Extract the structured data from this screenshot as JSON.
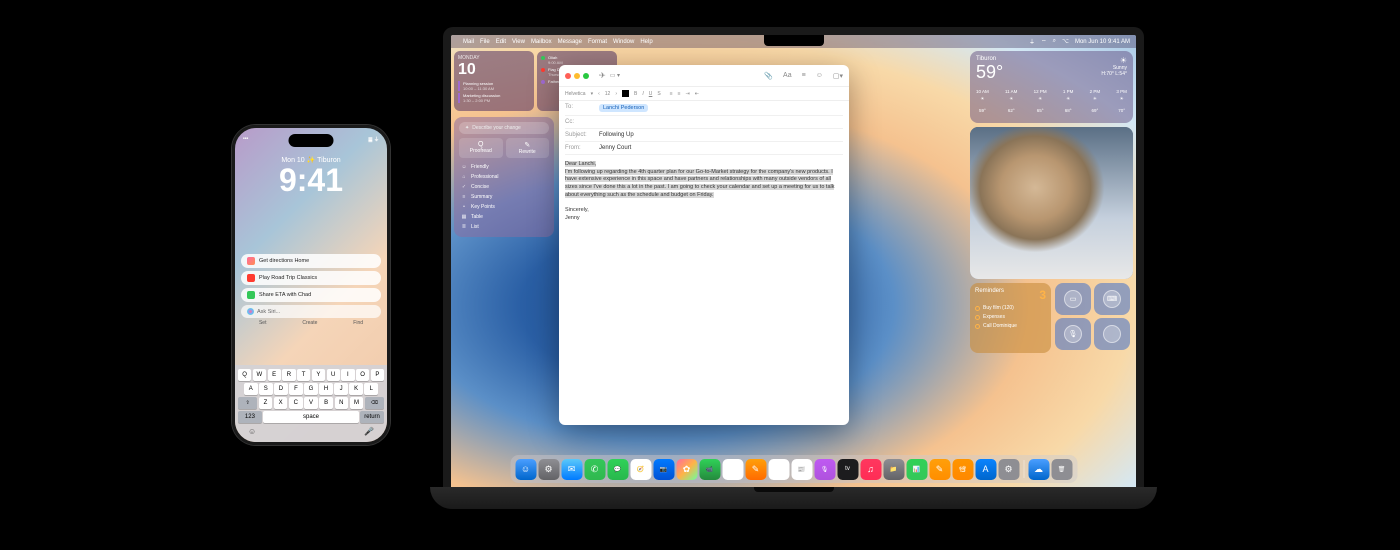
{
  "iphone": {
    "date_line": "Mon 10 ✨ Tiburon",
    "time": "9:41",
    "suggestions": [
      {
        "icon_color": "linear-gradient(135deg,#ff6b9d,#ff8e53)",
        "label": "Get directions Home"
      },
      {
        "icon_color": "#ff3b30",
        "label": "Play Road Trip Classics"
      },
      {
        "icon_color": "#34c759",
        "label": "Share ETA with Chad"
      }
    ],
    "siri_placeholder": "Ask Siri...",
    "tabs": [
      "Set",
      "Create",
      "Find"
    ],
    "keyboard": {
      "r1": [
        "Q",
        "W",
        "E",
        "R",
        "T",
        "Y",
        "U",
        "I",
        "O",
        "P"
      ],
      "r2": [
        "A",
        "S",
        "D",
        "F",
        "G",
        "H",
        "J",
        "K",
        "L"
      ],
      "r3": [
        "⇧",
        "Z",
        "X",
        "C",
        "V",
        "B",
        "N",
        "M",
        "⌫"
      ],
      "r4": [
        "123",
        "space",
        "return"
      ]
    }
  },
  "mac": {
    "menubar_left": [
      "",
      "Mail",
      "File",
      "Edit",
      "View",
      "Mailbox",
      "Message",
      "Format",
      "Window",
      "Help"
    ],
    "menubar_right": "Mon Jun 10  9:41 AM",
    "calendar": {
      "day": "MONDAY",
      "num": "10",
      "items": [
        {
          "title": "Planning session",
          "sub": "10:00 – 11:30 AM"
        },
        {
          "title": "Marketing discussion",
          "sub": "1:30 – 2:00 PM"
        }
      ]
    },
    "calendar2": [
      {
        "color": "#34c759",
        "title": "Oliah",
        "sub": "9:00 AM"
      },
      {
        "color": "#ff3b30",
        "title": "Flag Day",
        "sub": "Thursday, June"
      },
      {
        "color": "#a06ad0",
        "title": "Father's Day",
        "sub": ""
      }
    ],
    "writing": {
      "placeholder": "Describe your change",
      "buttons": [
        "Proofread",
        "Rewrite"
      ],
      "button_icons": [
        "Q",
        "✎"
      ],
      "options": [
        "Friendly",
        "Professional",
        "Concise",
        "Summary",
        "Key Points",
        "Table",
        "List"
      ],
      "option_icons": [
        "☺",
        "⌂",
        "✓",
        "≡",
        "•",
        "▦",
        "≣"
      ]
    },
    "mail": {
      "font": "Helvetica",
      "size": "12",
      "to_label": "To:",
      "to_val": "Lanchi Pederson",
      "cc_label": "Cc:",
      "subject_label": "Subject:",
      "subject_val": "Following Up",
      "from_label": "From:",
      "from_val": "Jenny Court",
      "body_greeting": "Dear Lanchi,",
      "body_para": "I'm following up regarding the 4th quarter plan for our Go-to-Market strategy for the company's new products. I have extensive experience in this space and have partners and relationships with many outside vendors of all sizes since I've done this a lot in the past. I am going to check your calendar and set up a meeting for us to talk about everything such as the schedule and budget on Friday.",
      "body_sign": "Sincerely,",
      "body_name": "Jenny"
    },
    "weather": {
      "location": "Tiburon",
      "temp": "59°",
      "icon": "☀",
      "cond": "Sunny",
      "hilo": "H:70° L:54°",
      "hours": [
        {
          "t": "10 AM",
          "i": "☀",
          "d": "59°"
        },
        {
          "t": "11 AM",
          "i": "☀",
          "d": "62°"
        },
        {
          "t": "12 PM",
          "i": "☀",
          "d": "65°"
        },
        {
          "t": "1 PM",
          "i": "☀",
          "d": "68°"
        },
        {
          "t": "2 PM",
          "i": "☀",
          "d": "69°"
        },
        {
          "t": "3 PM",
          "i": "☀",
          "d": "70°"
        }
      ]
    },
    "reminders": {
      "title": "Reminders",
      "count": "3",
      "items": [
        "Buy film (120)",
        "Expenses",
        "Call Dominique"
      ]
    },
    "dock": [
      {
        "bg": "linear-gradient(#4a9eff,#0066cc)",
        "icon": "☺"
      },
      {
        "bg": "linear-gradient(#8e8e93,#636366)",
        "icon": "⚙"
      },
      {
        "bg": "linear-gradient(#5ac8fa,#007aff)",
        "icon": "✉"
      },
      {
        "bg": "linear-gradient(#34c759,#30b84f)",
        "icon": "✆"
      },
      {
        "bg": "linear-gradient(#30d158,#28b84d)",
        "icon": "💬"
      },
      {
        "bg": "#fff",
        "icon": "🧭"
      },
      {
        "bg": "linear-gradient(#007aff,#0051d5)",
        "icon": "📷"
      },
      {
        "bg": "linear-gradient(135deg,#ff6b9d,#ffb347,#6bff9d)",
        "icon": "✿"
      },
      {
        "bg": "linear-gradient(#30d158,#248a3d)",
        "icon": "📹"
      },
      {
        "bg": "#fff",
        "icon": "10"
      },
      {
        "bg": "linear-gradient(#ff9f0a,#ff6b00)",
        "icon": "✎"
      },
      {
        "bg": "#fff",
        "icon": "✓"
      },
      {
        "bg": "#fff",
        "icon": "📰"
      },
      {
        "bg": "linear-gradient(#bf5af2,#af52de)",
        "icon": "🎙"
      },
      {
        "bg": "#1c1c1e",
        "icon": "tv"
      },
      {
        "bg": "linear-gradient(#ff375f,#ff2d55)",
        "icon": "♫"
      },
      {
        "bg": "linear-gradient(#8e8e93,#636366)",
        "icon": "📁"
      },
      {
        "bg": "linear-gradient(#30d158,#34c759)",
        "icon": "📊"
      },
      {
        "bg": "linear-gradient(#ff9f0a,#ff8e00)",
        "icon": "✎"
      },
      {
        "bg": "linear-gradient(#ff9500,#ff8800)",
        "icon": "📽"
      },
      {
        "bg": "linear-gradient(#0a84ff,#0066cc)",
        "icon": "A"
      },
      {
        "bg": "#8e8e93",
        "icon": "⚙"
      },
      {
        "bg": "linear-gradient(#4a9eff,#0066cc)",
        "icon": "☁"
      },
      {
        "bg": "#8e8e93",
        "icon": "🗑"
      }
    ]
  }
}
